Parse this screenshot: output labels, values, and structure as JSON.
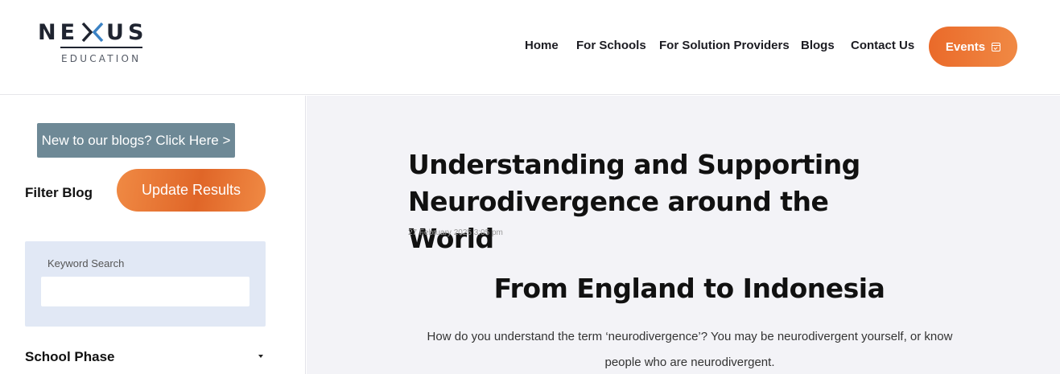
{
  "logo": {
    "word_left": "NE",
    "word_right": "US",
    "sub": "EDUCATION"
  },
  "nav": {
    "items": [
      "Home",
      "For Schools",
      "For Solution Providers",
      "Blogs",
      "Contact Us"
    ],
    "events_label": "Events"
  },
  "sidebar": {
    "new_blogs_label": "New to our blogs? Click Here >",
    "filter_label": "Filter Blog",
    "update_label": "Update Results",
    "search_label": "Keyword Search",
    "search_value": "",
    "phase_label": "School Phase"
  },
  "post": {
    "title": "Understanding and Supporting Neurodivergence around the World",
    "date": "27 February 2025 3:05 pm",
    "section_heading": "From England to Indonesia",
    "body": "How do you understand the term ‘neurodivergence’? You may be neurodivergent yourself, or know people who are neurodivergent."
  },
  "colors": {
    "accent": "#ea6a2a",
    "slate_button": "#6e8996",
    "panel": "#e1e8f5"
  }
}
